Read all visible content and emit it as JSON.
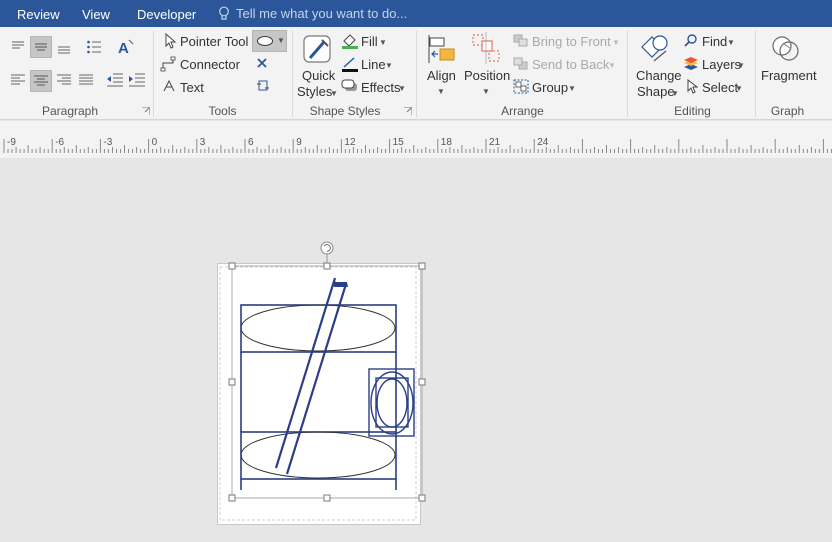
{
  "tabs": [
    {
      "label": "Review"
    },
    {
      "label": "View"
    },
    {
      "label": "Developer"
    }
  ],
  "tell_me": {
    "placeholder": "Tell me what you want to do..."
  },
  "groups": {
    "paragraph": {
      "label": "Paragraph"
    },
    "tools": {
      "label": "Tools",
      "pointer_tool": "Pointer Tool",
      "connector": "Connector",
      "text": "Text"
    },
    "shape_styles": {
      "label": "Shape Styles",
      "quick_styles_line1": "Quick",
      "quick_styles_line2": "Styles",
      "fill": "Fill",
      "line": "Line",
      "effects": "Effects"
    },
    "arrange": {
      "label": "Arrange",
      "align": "Align",
      "position": "Position",
      "bring_to_front": "Bring to Front",
      "send_to_back": "Send to Back",
      "group": "Group"
    },
    "editing": {
      "label": "Editing",
      "change_shape_line1": "Change",
      "change_shape_line2": "Shape",
      "find": "Find",
      "layers": "Layers",
      "select": "Select"
    },
    "graph": {
      "label": "Graph",
      "fragment": "Fragment"
    }
  },
  "ruler": {
    "labels": [
      "-9",
      "-6",
      "-3",
      "0",
      "3",
      "6",
      "9",
      "12",
      "15",
      "18",
      "21",
      "24"
    ]
  },
  "colors": {
    "tab_bar": "#2b579a",
    "shape_stroke": "#2a3f86",
    "ribbon_bg": "#f3f3f3",
    "canvas_bg": "#e6e6e6"
  }
}
